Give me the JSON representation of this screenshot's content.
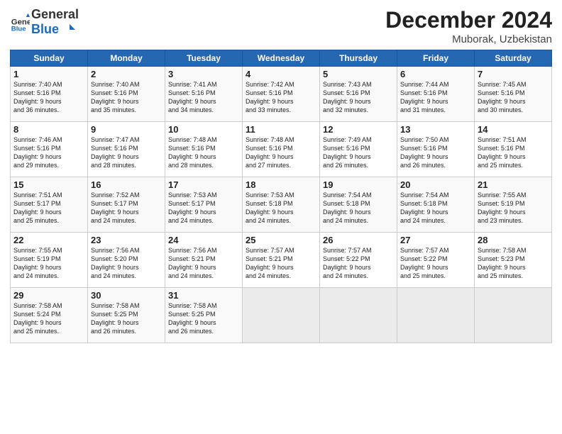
{
  "header": {
    "logo_general": "General",
    "logo_blue": "Blue",
    "month_year": "December 2024",
    "location": "Muborak, Uzbekistan"
  },
  "weekdays": [
    "Sunday",
    "Monday",
    "Tuesday",
    "Wednesday",
    "Thursday",
    "Friday",
    "Saturday"
  ],
  "weeks": [
    [
      {
        "day": "1",
        "info": "Sunrise: 7:40 AM\nSunset: 5:16 PM\nDaylight: 9 hours\nand 36 minutes."
      },
      {
        "day": "2",
        "info": "Sunrise: 7:40 AM\nSunset: 5:16 PM\nDaylight: 9 hours\nand 35 minutes."
      },
      {
        "day": "3",
        "info": "Sunrise: 7:41 AM\nSunset: 5:16 PM\nDaylight: 9 hours\nand 34 minutes."
      },
      {
        "day": "4",
        "info": "Sunrise: 7:42 AM\nSunset: 5:16 PM\nDaylight: 9 hours\nand 33 minutes."
      },
      {
        "day": "5",
        "info": "Sunrise: 7:43 AM\nSunset: 5:16 PM\nDaylight: 9 hours\nand 32 minutes."
      },
      {
        "day": "6",
        "info": "Sunrise: 7:44 AM\nSunset: 5:16 PM\nDaylight: 9 hours\nand 31 minutes."
      },
      {
        "day": "7",
        "info": "Sunrise: 7:45 AM\nSunset: 5:16 PM\nDaylight: 9 hours\nand 30 minutes."
      }
    ],
    [
      {
        "day": "8",
        "info": "Sunrise: 7:46 AM\nSunset: 5:16 PM\nDaylight: 9 hours\nand 29 minutes."
      },
      {
        "day": "9",
        "info": "Sunrise: 7:47 AM\nSunset: 5:16 PM\nDaylight: 9 hours\nand 28 minutes."
      },
      {
        "day": "10",
        "info": "Sunrise: 7:48 AM\nSunset: 5:16 PM\nDaylight: 9 hours\nand 28 minutes."
      },
      {
        "day": "11",
        "info": "Sunrise: 7:48 AM\nSunset: 5:16 PM\nDaylight: 9 hours\nand 27 minutes."
      },
      {
        "day": "12",
        "info": "Sunrise: 7:49 AM\nSunset: 5:16 PM\nDaylight: 9 hours\nand 26 minutes."
      },
      {
        "day": "13",
        "info": "Sunrise: 7:50 AM\nSunset: 5:16 PM\nDaylight: 9 hours\nand 26 minutes."
      },
      {
        "day": "14",
        "info": "Sunrise: 7:51 AM\nSunset: 5:16 PM\nDaylight: 9 hours\nand 25 minutes."
      }
    ],
    [
      {
        "day": "15",
        "info": "Sunrise: 7:51 AM\nSunset: 5:17 PM\nDaylight: 9 hours\nand 25 minutes."
      },
      {
        "day": "16",
        "info": "Sunrise: 7:52 AM\nSunset: 5:17 PM\nDaylight: 9 hours\nand 24 minutes."
      },
      {
        "day": "17",
        "info": "Sunrise: 7:53 AM\nSunset: 5:17 PM\nDaylight: 9 hours\nand 24 minutes."
      },
      {
        "day": "18",
        "info": "Sunrise: 7:53 AM\nSunset: 5:18 PM\nDaylight: 9 hours\nand 24 minutes."
      },
      {
        "day": "19",
        "info": "Sunrise: 7:54 AM\nSunset: 5:18 PM\nDaylight: 9 hours\nand 24 minutes."
      },
      {
        "day": "20",
        "info": "Sunrise: 7:54 AM\nSunset: 5:18 PM\nDaylight: 9 hours\nand 24 minutes."
      },
      {
        "day": "21",
        "info": "Sunrise: 7:55 AM\nSunset: 5:19 PM\nDaylight: 9 hours\nand 23 minutes."
      }
    ],
    [
      {
        "day": "22",
        "info": "Sunrise: 7:55 AM\nSunset: 5:19 PM\nDaylight: 9 hours\nand 24 minutes."
      },
      {
        "day": "23",
        "info": "Sunrise: 7:56 AM\nSunset: 5:20 PM\nDaylight: 9 hours\nand 24 minutes."
      },
      {
        "day": "24",
        "info": "Sunrise: 7:56 AM\nSunset: 5:21 PM\nDaylight: 9 hours\nand 24 minutes."
      },
      {
        "day": "25",
        "info": "Sunrise: 7:57 AM\nSunset: 5:21 PM\nDaylight: 9 hours\nand 24 minutes."
      },
      {
        "day": "26",
        "info": "Sunrise: 7:57 AM\nSunset: 5:22 PM\nDaylight: 9 hours\nand 24 minutes."
      },
      {
        "day": "27",
        "info": "Sunrise: 7:57 AM\nSunset: 5:22 PM\nDaylight: 9 hours\nand 25 minutes."
      },
      {
        "day": "28",
        "info": "Sunrise: 7:58 AM\nSunset: 5:23 PM\nDaylight: 9 hours\nand 25 minutes."
      }
    ],
    [
      {
        "day": "29",
        "info": "Sunrise: 7:58 AM\nSunset: 5:24 PM\nDaylight: 9 hours\nand 25 minutes."
      },
      {
        "day": "30",
        "info": "Sunrise: 7:58 AM\nSunset: 5:25 PM\nDaylight: 9 hours\nand 26 minutes."
      },
      {
        "day": "31",
        "info": "Sunrise: 7:58 AM\nSunset: 5:25 PM\nDaylight: 9 hours\nand 26 minutes."
      },
      {
        "day": "",
        "info": ""
      },
      {
        "day": "",
        "info": ""
      },
      {
        "day": "",
        "info": ""
      },
      {
        "day": "",
        "info": ""
      }
    ]
  ]
}
